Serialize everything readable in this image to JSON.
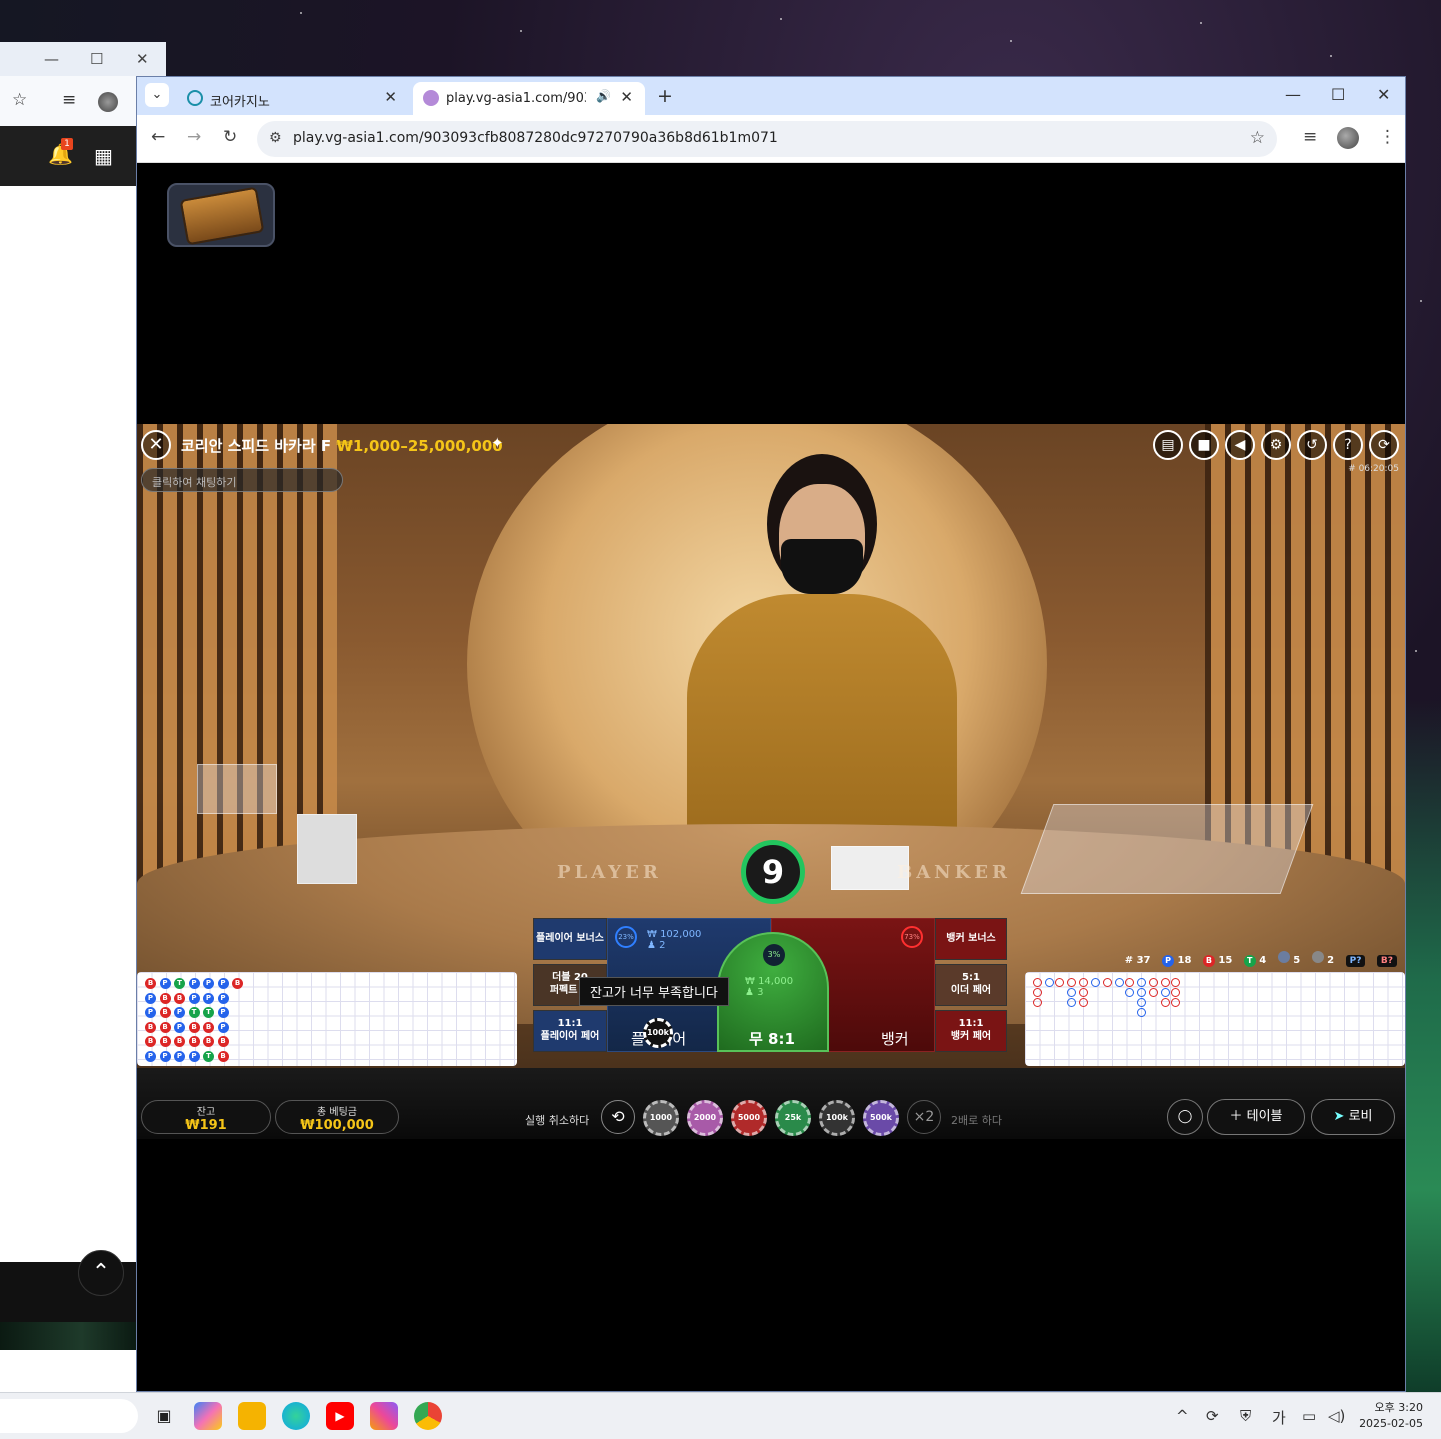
{
  "back_window": {
    "badge": "1"
  },
  "browser": {
    "tabs": [
      {
        "label": "코어카지노"
      },
      {
        "label": "play.vg-asia1.com/903093c"
      }
    ],
    "url": "play.vg-asia1.com/903093cfb8087280dc97270790a36b8d61b1m071"
  },
  "game": {
    "title": "코리안 스피드 바카라 F",
    "limits": "₩1,000–25,000,000",
    "chat_placeholder": "클릭하여 채팅하기",
    "time": "# 06:20:05",
    "timer": "9",
    "table_player": "PLAYER",
    "table_banker": "BANKER",
    "stats": {
      "round": "# 37",
      "p_label": "P",
      "p_count": "18",
      "b_label": "B",
      "b_count": "15",
      "t_label": "T",
      "t_count": "4",
      "pp_count": "5",
      "bp_count": "2",
      "p_predict": "P?",
      "b_predict": "B?"
    },
    "bets": {
      "player_bonus": "플레이어 보너스",
      "banker_bonus": "뱅커 보너스",
      "perfect_pair_top": "더블 20",
      "perfect_pair_bottom": "퍼펙트 페",
      "either_pair_ratio": "5:1",
      "either_pair": "이더 페어",
      "player_pair_ratio": "11:1",
      "player_pair": "플레이어 페어",
      "banker_pair_ratio": "11:1",
      "banker_pair": "뱅커 페어",
      "player": "플레이어",
      "banker": "뱅커",
      "tie": "무 8:1",
      "player_amount": "₩ 102,000",
      "player_count": "2",
      "player_pct": "23%",
      "tie_amount": "₩ 14,000",
      "tie_count": "3",
      "tie_pct": "3%",
      "banker_pct": "73%",
      "chip_on_player": "100k"
    },
    "tooltip": "잔고가 너무 부족합니다",
    "balance_label": "잔고",
    "balance_value": "₩191",
    "total_bet_label": "총 베팅금",
    "total_bet_value": "₩100,000",
    "undo_label": "실행 취소하다",
    "chips": [
      "1000",
      "2000",
      "5000",
      "25k",
      "100k",
      "500k"
    ],
    "double": "×2",
    "double_label": "2배로 하다",
    "table_btn": "테이블",
    "lobby_btn": "로비"
  },
  "taskbar": {
    "ime": "가",
    "clock_time": "오후 3:20",
    "clock_date": "2025-02-05"
  },
  "colors": {
    "accent_gold": "#f5c518",
    "player_blue": "#1f3a6e",
    "banker_red": "#7a1414",
    "tie_green": "#3fae3f"
  }
}
